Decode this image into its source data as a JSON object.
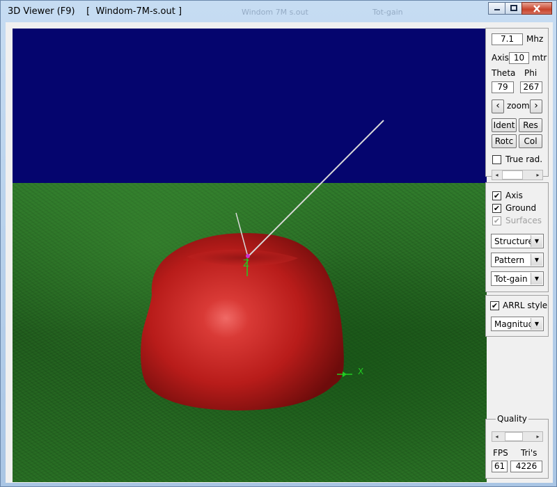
{
  "window": {
    "title": "3D Viewer (F9)    [  Windom-7M-s.out ]",
    "ghost_texts": [
      "Windom 7M s.out",
      "Tot-gain"
    ],
    "caption_buttons": [
      "minimize-icon",
      "maximize-icon",
      "close-icon"
    ]
  },
  "controls": {
    "freq_value": "7.1",
    "freq_unit": "Mhz",
    "axis_label": "Axis",
    "axis_value": "10",
    "axis_unit": "mtr",
    "theta_label": "Theta",
    "phi_label": "Phi",
    "theta_value": "79",
    "phi_value": "267",
    "zoom_label": "zoom",
    "zoom_left": "‹",
    "zoom_right": "›",
    "ident_label": "Ident",
    "res_label": "Res",
    "rotc_label": "Rotc",
    "col_label": "Col",
    "true_rad_label": "True rad.",
    "true_rad_checked": false
  },
  "display": {
    "axis_label": "Axis",
    "axis_checked": true,
    "ground_label": "Ground",
    "ground_checked": true,
    "surfaces_label": "Surfaces",
    "surfaces_checked": true,
    "surfaces_disabled": true,
    "dropdowns": [
      "Structure",
      "Pattern",
      "Tot-gain"
    ]
  },
  "style": {
    "arrl_label": "ARRL style",
    "arrl_checked": true,
    "scale_value": "Magnitude"
  },
  "quality": {
    "label": "Quality",
    "fps_label": "FPS",
    "tris_label": "Tri's",
    "fps_value": "61",
    "tris_value": "4226"
  },
  "scene": {
    "z_axis_label": "Z",
    "x_axis_label": "X",
    "sky_color": "#05056e",
    "pattern_color": "#c8201e",
    "axis_color": "#22cc22",
    "wire_color": "#d8d8d8"
  }
}
